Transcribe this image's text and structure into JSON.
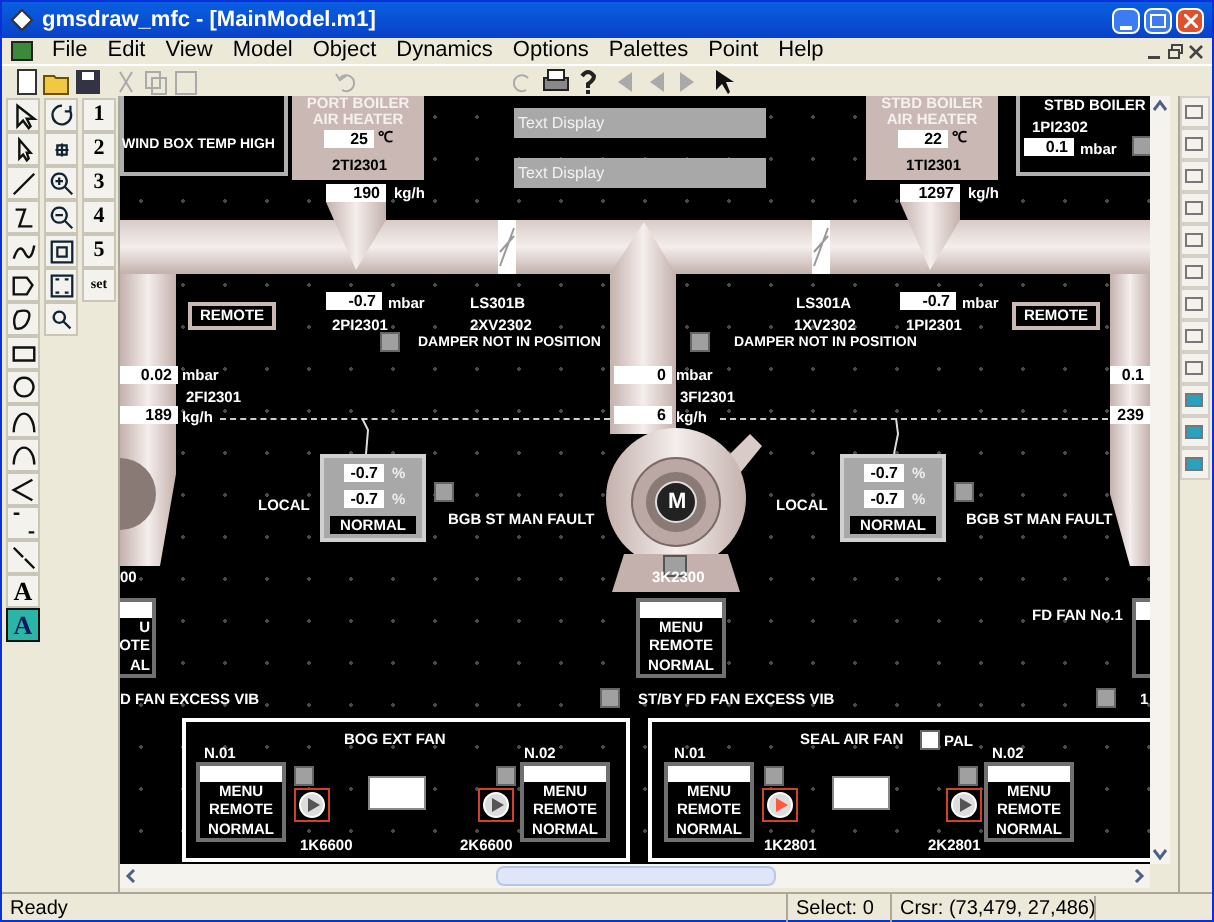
{
  "window": {
    "title": "gmsdraw_mfc - [MainModel.m1]"
  },
  "menu": [
    "File",
    "Edit",
    "View",
    "Model",
    "Object",
    "Dynamics",
    "Options",
    "Palettes",
    "Point",
    "Help"
  ],
  "toolbox": {
    "numbers": [
      "1",
      "2",
      "3",
      "4",
      "5",
      "set"
    ],
    "text_tools": [
      {
        "label": "A",
        "selected": false
      },
      {
        "label": "A",
        "selected": true
      }
    ]
  },
  "canvas": {
    "top_left_panel": {
      "alarm": "WIND BOX TEMP HIGH"
    },
    "air_heaters": [
      {
        "title": "PORT BOILER AIR HEATER",
        "temp": "25",
        "temp_unit": "℃",
        "tag": "2TI2301",
        "flow": "190",
        "flow_unit": "kg/h"
      },
      {
        "title": "STBD BOILER AIR HEATER",
        "temp": "22",
        "temp_unit": "℃",
        "tag": "1TI2301",
        "flow": "1297",
        "flow_unit": "kg/h"
      }
    ],
    "text_displays": [
      "Text Display",
      "Text Display"
    ],
    "stbd_boiler_panel": {
      "title": "STBD BOILER",
      "tag": "1PI2302",
      "value": "0.1",
      "unit": "mbar",
      "alarm_active": false
    },
    "duct_dampers": [
      {
        "switch": "LS301B",
        "valve": "2XV2302",
        "pressure": "-0.7",
        "pressure_unit": "mbar",
        "pressure_tag": "2PI2301",
        "mode": "REMOTE",
        "alarm": "DAMPER NOT IN POSITION",
        "alarm_active": false
      },
      {
        "switch": "LS301A",
        "valve": "1XV2302",
        "pressure": "-0.7",
        "pressure_unit": "mbar",
        "pressure_tag": "1PI2301",
        "mode": "REMOTE",
        "alarm": "DAMPER NOT IN POSITION",
        "alarm_active": false
      }
    ],
    "fan_inlets": [
      {
        "pressure": "0.02",
        "pressure_unit": "mbar",
        "tag": "2FI2301",
        "flow": "189",
        "flow_unit": "kg/h"
      },
      {
        "pressure": "0",
        "pressure_unit": "mbar",
        "tag": "3FI2301",
        "flow": "6",
        "flow_unit": "kg/h"
      },
      {
        "pressure": "0.1",
        "flow": "239"
      }
    ],
    "vane_controls": [
      {
        "mode": "LOCAL",
        "readings": [
          {
            "value": "-0.7",
            "unit": "%"
          },
          {
            "value": "-0.7",
            "unit": "%"
          }
        ],
        "status": "NORMAL",
        "alarm": "BGB ST MAN FAULT",
        "alarm_active": false
      },
      {
        "mode": "LOCAL",
        "readings": [
          {
            "value": "-0.7",
            "unit": "%"
          },
          {
            "value": "-0.7",
            "unit": "%"
          }
        ],
        "status": "NORMAL",
        "alarm": "BGB ST MAN FAULT",
        "alarm_active": false
      }
    ],
    "fd_fans": [
      {
        "tag": "00",
        "panel": [
          "U",
          "OTE",
          "AL"
        ],
        "alarm": "D FAN EXCESS VIB"
      },
      {
        "motor": "M",
        "tag": "3K2300",
        "panel": [
          "MENU",
          "REMOTE",
          "NORMAL"
        ],
        "alarm": "ST/BY FD FAN EXCESS VIB",
        "alarm_active": false
      },
      {
        "label": "FD FAN No.1",
        "alarm": "1",
        "alarm_active": false
      }
    ],
    "fan_groups": [
      {
        "title": "BOG EXT FAN",
        "units": [
          {
            "label": "N.01",
            "tag": "1K6600",
            "panel": [
              "MENU",
              "REMOTE",
              "NORMAL"
            ],
            "running": false,
            "alarm_active": false
          },
          {
            "label": "N.02",
            "tag": "2K6600",
            "panel": [
              "MENU",
              "REMOTE",
              "NORMAL"
            ],
            "running": false,
            "alarm_active": false
          }
        ]
      },
      {
        "title": "SEAL AIR FAN",
        "pal": {
          "label": "PAL",
          "active": true
        },
        "units": [
          {
            "label": "N.01",
            "tag": "1K2801",
            "panel": [
              "MENU",
              "REMOTE",
              "NORMAL"
            ],
            "running": true,
            "alarm_active": false
          },
          {
            "label": "N.02",
            "tag": "2K2801",
            "panel": [
              "MENU",
              "REMOTE",
              "NORMAL"
            ],
            "running": false,
            "alarm_active": false
          }
        ]
      }
    ]
  },
  "status_bar": {
    "message": "Ready",
    "selection": "Select: 0",
    "cursor": "Crsr: (73,479, 27,486)"
  }
}
